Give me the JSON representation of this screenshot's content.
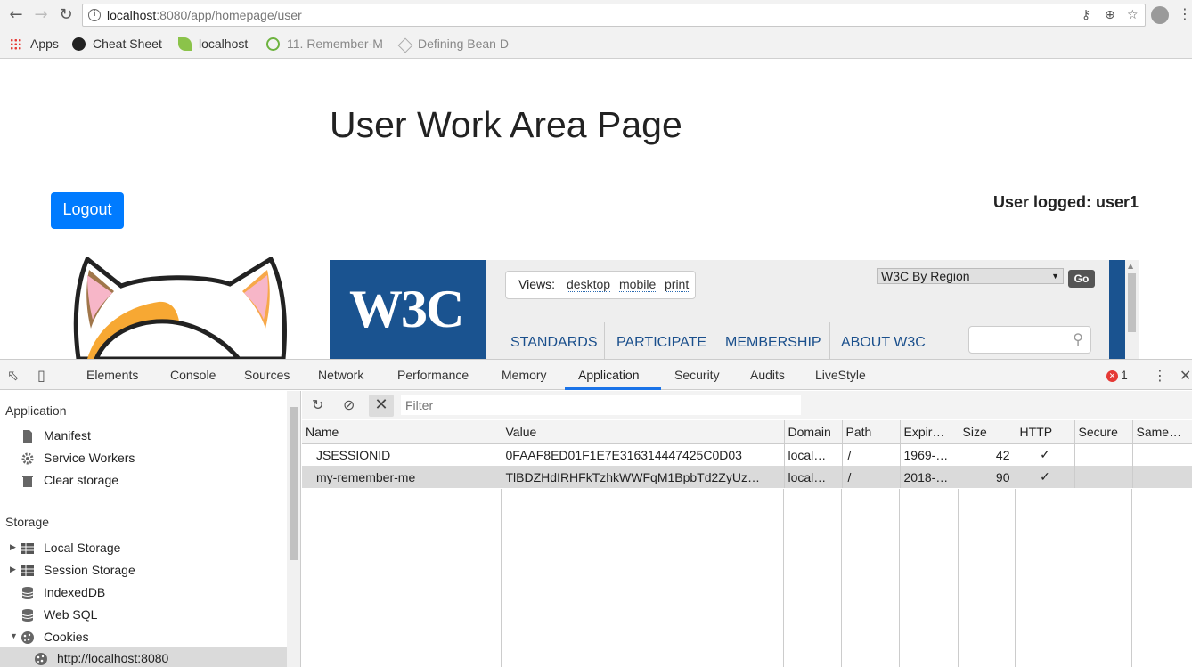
{
  "browser": {
    "url_host": "localhost",
    "url_rest": ":8080/app/homepage/user",
    "bookmarks": [
      {
        "label": "Apps"
      },
      {
        "label": "Cheat Sheet"
      },
      {
        "label": "localhost"
      },
      {
        "label": "11. Remember-M"
      },
      {
        "label": "Defining Bean D"
      }
    ]
  },
  "page": {
    "title": "User Work Area Page",
    "logout_label": "Logout",
    "logged_user": "User logged: user1"
  },
  "w3c": {
    "logo": "W3C",
    "views_label": "Views:",
    "view_options": [
      "desktop",
      "mobile",
      "print"
    ],
    "region_select": "W3C By Region",
    "go_label": "Go",
    "nav": [
      "STANDARDS",
      "PARTICIPATE",
      "MEMBERSHIP",
      "ABOUT W3C"
    ]
  },
  "devtools": {
    "tabs": [
      "Elements",
      "Console",
      "Sources",
      "Network",
      "Performance",
      "Memory",
      "Application",
      "Security",
      "Audits",
      "LiveStyle"
    ],
    "active_tab": "Application",
    "error_count": "1",
    "sidebar": {
      "application_header": "Application",
      "application_items": [
        "Manifest",
        "Service Workers",
        "Clear storage"
      ],
      "storage_header": "Storage",
      "storage_items": [
        "Local Storage",
        "Session Storage",
        "IndexedDB",
        "Web SQL",
        "Cookies"
      ],
      "cookie_origin": "http://localhost:8080"
    },
    "filter_placeholder": "Filter",
    "columns": [
      "Name",
      "Value",
      "Domain",
      "Path",
      "Expir…",
      "Size",
      "HTTP",
      "Secure",
      "Same…"
    ],
    "rows": [
      {
        "name": "JSESSIONID",
        "value": "0FAAF8ED01F1E7E316314447425C0D03",
        "domain": "local…",
        "path": "/",
        "expires": "1969-…",
        "size": "42",
        "http": "✓",
        "secure": "",
        "same": ""
      },
      {
        "name": "my-remember-me",
        "value": "TlBDZHdIRHFkTzhkWWFqM1BpbTd2ZyUz…",
        "domain": "local…",
        "path": "/",
        "expires": "2018-…",
        "size": "90",
        "http": "✓",
        "secure": "",
        "same": ""
      }
    ]
  }
}
